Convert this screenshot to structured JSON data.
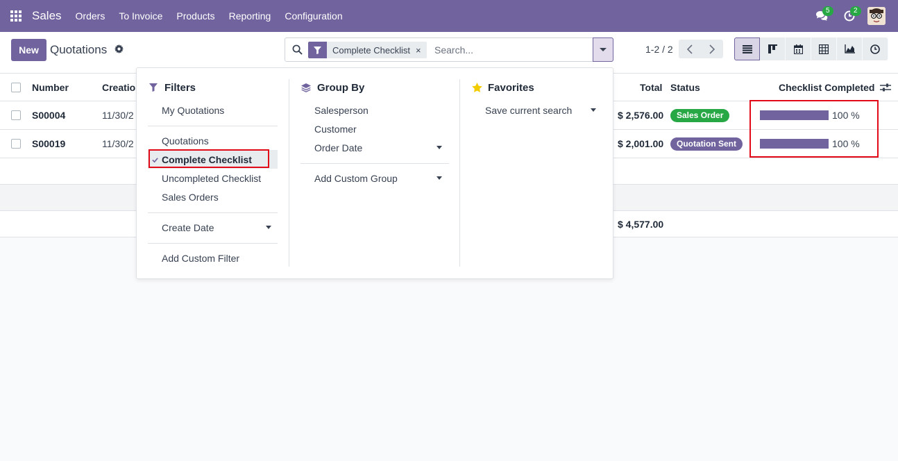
{
  "navbar": {
    "app_name": "Sales",
    "menu": [
      "Orders",
      "To Invoice",
      "Products",
      "Reporting",
      "Configuration"
    ],
    "messages_count": "5",
    "activities_count": "2"
  },
  "control_panel": {
    "new_label": "New",
    "title": "Quotations",
    "facet_label": "Complete Checklist",
    "facet_remove": "×",
    "search_placeholder": "Search...",
    "pager": "1-2 / 2"
  },
  "list": {
    "headers": {
      "number": "Number",
      "creation": "Creatio",
      "total": "Total",
      "status": "Status",
      "checklist": "Checklist Completed"
    },
    "rows": [
      {
        "number": "S00004",
        "creation": "11/30/2",
        "total": "$ 2,576.00",
        "status": "Sales Order",
        "status_color": "#28a745",
        "checklist_value": 100,
        "checklist_label": "100 %"
      },
      {
        "number": "S00019",
        "creation": "11/30/2",
        "total": "$ 2,001.00",
        "status": "Quotation Sent",
        "status_color": "#71639e",
        "checklist_value": 100,
        "checklist_label": "100 %"
      }
    ],
    "grand_total": "$ 4,577.00"
  },
  "dropdown": {
    "filters": {
      "title": "Filters",
      "items": [
        "My Quotations",
        "Quotations",
        "Complete Checklist",
        "Uncompleted Checklist",
        "Sales Orders",
        "Create Date",
        "Add Custom Filter"
      ]
    },
    "group_by": {
      "title": "Group By",
      "items": [
        "Salesperson",
        "Customer",
        "Order Date",
        "Add Custom Group"
      ]
    },
    "favorites": {
      "title": "Favorites",
      "items": [
        "Save current search"
      ]
    }
  },
  "colors": {
    "brand": "#71639e",
    "success": "#28a745",
    "highlight": "#e30a17"
  }
}
